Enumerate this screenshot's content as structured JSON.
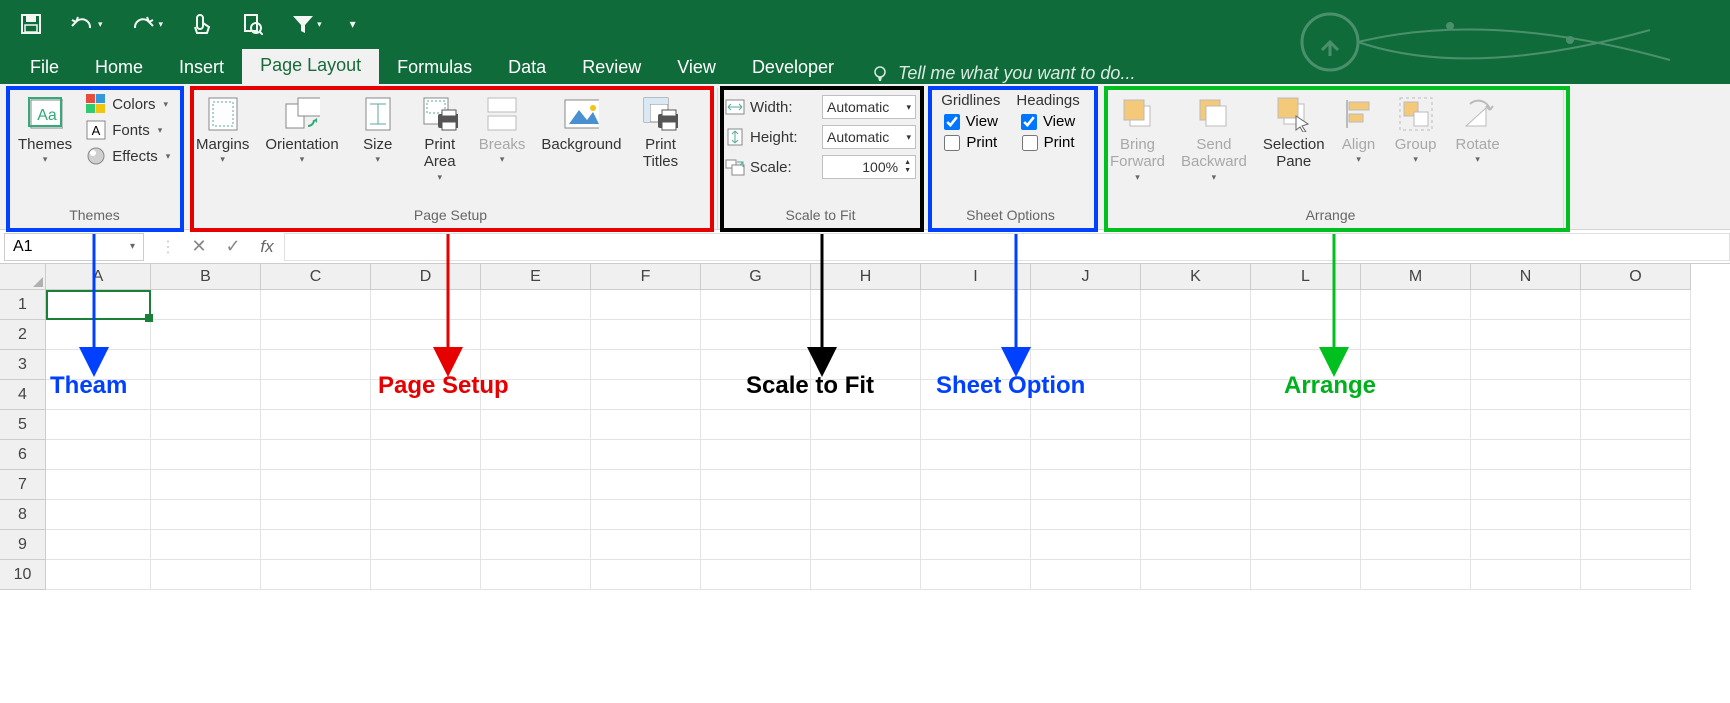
{
  "qat": {
    "items": [
      "save",
      "undo",
      "redo",
      "touch-mode",
      "print-preview",
      "filter",
      "customize"
    ]
  },
  "tabs": {
    "items": [
      {
        "label": "File"
      },
      {
        "label": "Home"
      },
      {
        "label": "Insert"
      },
      {
        "label": "Page Layout",
        "active": true
      },
      {
        "label": "Formulas"
      },
      {
        "label": "Data"
      },
      {
        "label": "Review"
      },
      {
        "label": "View"
      },
      {
        "label": "Developer"
      }
    ],
    "search_placeholder": "Tell me what you want to do..."
  },
  "ribbon": {
    "themes": {
      "label": "Themes",
      "themes_btn": "Themes",
      "colors": "Colors",
      "fonts": "Fonts",
      "effects": "Effects"
    },
    "pagesetup": {
      "label": "Page Setup",
      "margins": "Margins",
      "orientation": "Orientation",
      "size": "Size",
      "printarea": "Print\nArea",
      "breaks": "Breaks",
      "background": "Background",
      "printtitles": "Print\nTitles"
    },
    "scaletofit": {
      "label": "Scale to Fit",
      "width_lbl": "Width:",
      "width_val": "Automatic",
      "height_lbl": "Height:",
      "height_val": "Automatic",
      "scale_lbl": "Scale:",
      "scale_val": "100%"
    },
    "sheetoptions": {
      "label": "Sheet Options",
      "gridlines": "Gridlines",
      "headings": "Headings",
      "view": "View",
      "print": "Print",
      "gridlines_view": true,
      "gridlines_print": false,
      "headings_view": true,
      "headings_print": false
    },
    "arrange": {
      "label": "Arrange",
      "bringforward": "Bring\nForward",
      "sendbackward": "Send\nBackward",
      "selectionpane": "Selection\nPane",
      "align": "Align",
      "group": "Group",
      "rotate": "Rotate"
    }
  },
  "fbar": {
    "namebox": "A1"
  },
  "grid": {
    "columns": [
      "A",
      "B",
      "C",
      "D",
      "E",
      "F",
      "G",
      "H",
      "I",
      "J",
      "K",
      "L",
      "M",
      "N",
      "O"
    ],
    "rows": [
      1,
      2,
      3,
      4,
      5,
      6,
      7,
      8,
      9,
      10
    ]
  },
  "annotations": {
    "theam": "Theam",
    "pagesetup": "Page Setup",
    "scaletofit": "Scale to Fit",
    "sheetoption": "Sheet Option",
    "arrange": "Arrange"
  }
}
